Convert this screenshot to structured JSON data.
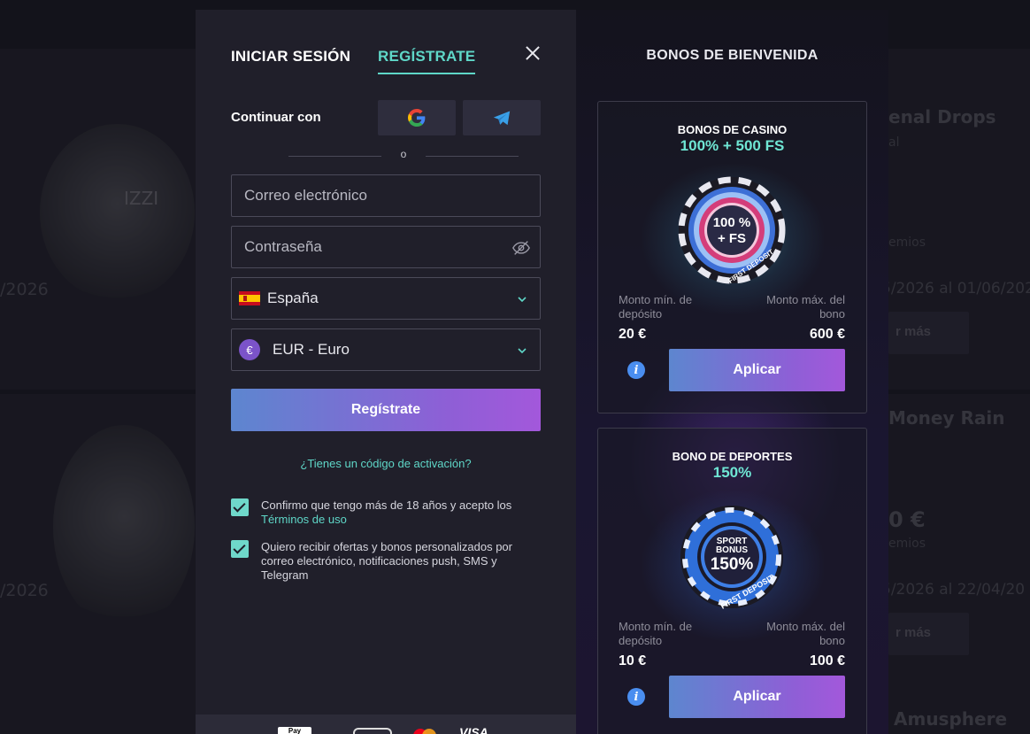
{
  "background": {
    "left_dates": [
      "/2026",
      "/2026"
    ],
    "brand": "IZZI",
    "right_titles": [
      "enal Drops",
      "Money Rain",
      "Amusphere"
    ],
    "right_small": [
      "al",
      "emios",
      "emios"
    ],
    "right_dates": [
      "5/2026 al 01/06/202",
      "5/2026 al 22/04/20"
    ],
    "right_prize": "0 €",
    "right_btn": "r más"
  },
  "modal": {
    "tabs": {
      "login": "INICIAR SESIÓN",
      "register": "REGÍSTRATE"
    },
    "continue_with": "Continuar con",
    "social": [
      "google-icon",
      "telegram-icon"
    ],
    "or_text": "o",
    "email_placeholder": "Correo electrónico",
    "password_placeholder": "Contraseña",
    "country": "España",
    "currency": "EUR - Euro",
    "currency_symbol": "€",
    "submit_label": "Regístrate",
    "activation_code_link": "¿Tienes un código de activación?",
    "consents": [
      {
        "text": "Confirmo que tengo más de 18 años y acepto los ",
        "link": "Términos de uso",
        "checked": true
      },
      {
        "text": "Quiero recibir ofertas y bonos personalizados por correo electrónico, notificaciones push, SMS y Telegram",
        "checked": true
      }
    ],
    "payments": [
      "Pay",
      "",
      "VISA"
    ]
  },
  "bonuses": {
    "title": "BONOS DE BIENVENIDA",
    "items": [
      {
        "category": "BONOS DE CASINO",
        "value": "100% + 500 FS",
        "chip_text": [
          "100 %",
          "+ FS"
        ],
        "chip_arc": "FIRST DEPOSIT",
        "min_label_1": "Monto mín. de",
        "min_label_2": "depósito",
        "max_label_1": "Monto máx. del",
        "max_label_2": "bono",
        "min_value": "20 €",
        "max_value": "600 €",
        "apply_label": "Aplicar"
      },
      {
        "category": "BONO DE DEPORTES",
        "value": "150%",
        "chip_text": [
          "SPORT",
          "BONUS",
          "150%"
        ],
        "chip_arc": "FIRST DEPOSIT",
        "min_label_1": "Monto mín. de",
        "min_label_2": "depósito",
        "max_label_1": "Monto máx. del",
        "max_label_2": "bono",
        "min_value": "10 €",
        "max_value": "100 €",
        "apply_label": "Aplicar"
      }
    ]
  },
  "colors": {
    "accent": "#5fd7c8",
    "button_start": "#5d86cf",
    "button_end": "#a358db",
    "checkbox": "#6fd8ca",
    "info": "#4a8ef0"
  }
}
